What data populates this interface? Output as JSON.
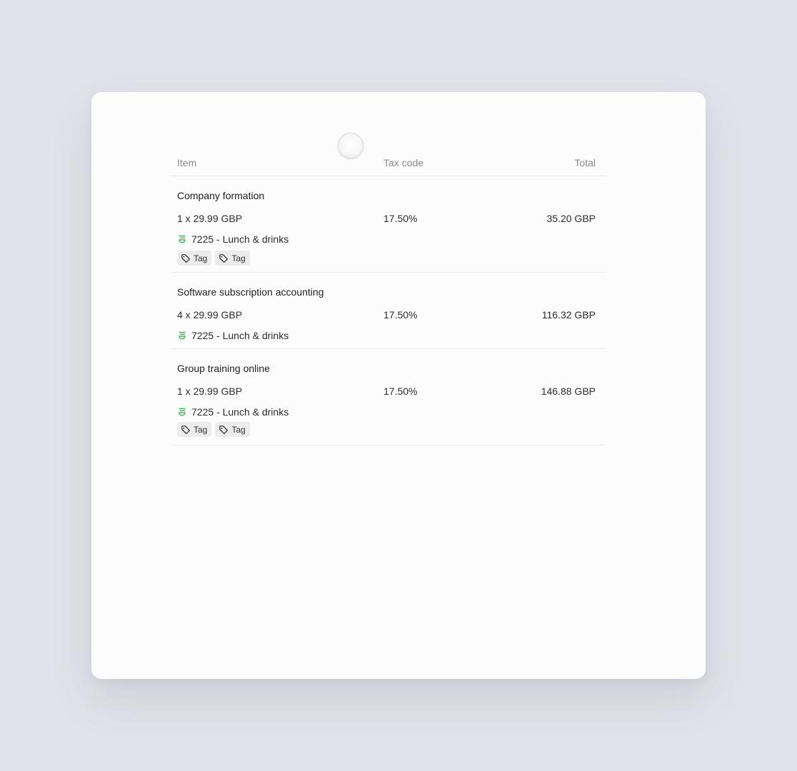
{
  "table": {
    "headers": {
      "item": "Item",
      "tax_code": "Tax code",
      "total": "Total"
    },
    "rows": [
      {
        "title": "Company formation",
        "quantity": "1 x 29.99 GBP",
        "tax": "17.50%",
        "total": "35.20 GBP",
        "account": "7225 - Lunch & drinks",
        "tags": [
          "Tag",
          "Tag"
        ]
      },
      {
        "title": "Software subscription accounting",
        "quantity": "4 x 29.99 GBP",
        "tax": "17.50%",
        "total": "116.32 GBP",
        "account": "7225 - Lunch & drinks",
        "tags": []
      },
      {
        "title": "Group training online",
        "quantity": "1 x 29.99 GBP",
        "tax": "17.50%",
        "total": "146.88 GBP",
        "account": "7225 - Lunch & drinks",
        "tags": [
          "Tag",
          "Tag"
        ]
      }
    ]
  },
  "icons": {
    "account": "account-category-icon",
    "tag": "tag-icon",
    "cursor": "cursor-indicator"
  },
  "colors": {
    "background": "#e2e3ea",
    "card": "#fcfcfc",
    "account_icon": "#4caf6e",
    "tag_bg": "#ececec"
  }
}
